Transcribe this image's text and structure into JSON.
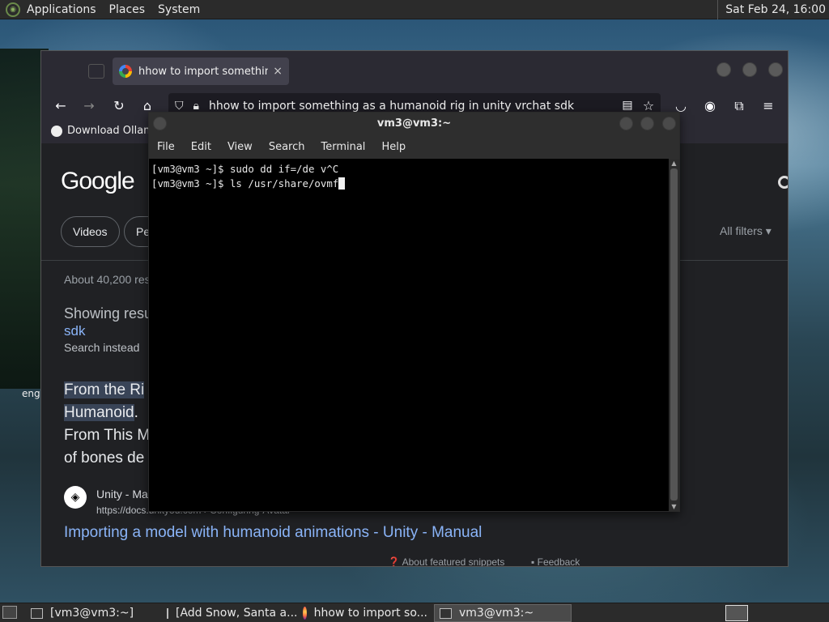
{
  "top_panel": {
    "menus": [
      "Applications",
      "Places",
      "System"
    ],
    "clock": "Sat Feb 24, 16:00"
  },
  "desktop": {
    "label": "eng"
  },
  "browser": {
    "tab_title": "hhow to import something as a humanoid rig",
    "tab_close": "×",
    "url": "hhow to import something as a humanoid rig in unity vrchat sdk",
    "bookmark": "Download Ollama",
    "google": {
      "logo": "Google",
      "chips": [
        "Videos",
        "Pe"
      ],
      "all_filters": "All filters",
      "results_count": "About 40,200 res",
      "showing_results": "Showing resu",
      "corrected_query": "sdk",
      "search_instead": "Search instead",
      "snippet_line1": "From the Ri",
      "snippet_line2": "Humanoid",
      "snippet_line3": "From This M",
      "snippet_line4": "of bones de",
      "source_name": "Unity - Ma",
      "source_url": "https://docs.unity3d.com › Configuring-Avatar",
      "result_link": "Importing a model with humanoid animations - Unity - Manual",
      "about_snippets": "About featured snippets",
      "feedback": "Feedback"
    }
  },
  "terminal": {
    "title": "vm3@vm3:~",
    "menu": [
      "File",
      "Edit",
      "View",
      "Search",
      "Terminal",
      "Help"
    ],
    "lines": [
      "[vm3@vm3 ~]$ sudo dd if=/de v^C",
      "[vm3@vm3 ~]$ ls /usr/share/ovmf"
    ]
  },
  "taskbar": {
    "tasks": [
      {
        "label": "[vm3@vm3:~]",
        "icon": "terminal-icon",
        "active": false
      },
      {
        "label": "[Add Snow, Santa a...",
        "icon": "window-icon",
        "active": false
      },
      {
        "label": "hhow to import so...",
        "icon": "firefox-icon",
        "active": false
      },
      {
        "label": "vm3@vm3:~",
        "icon": "terminal-icon",
        "active": true
      }
    ]
  }
}
